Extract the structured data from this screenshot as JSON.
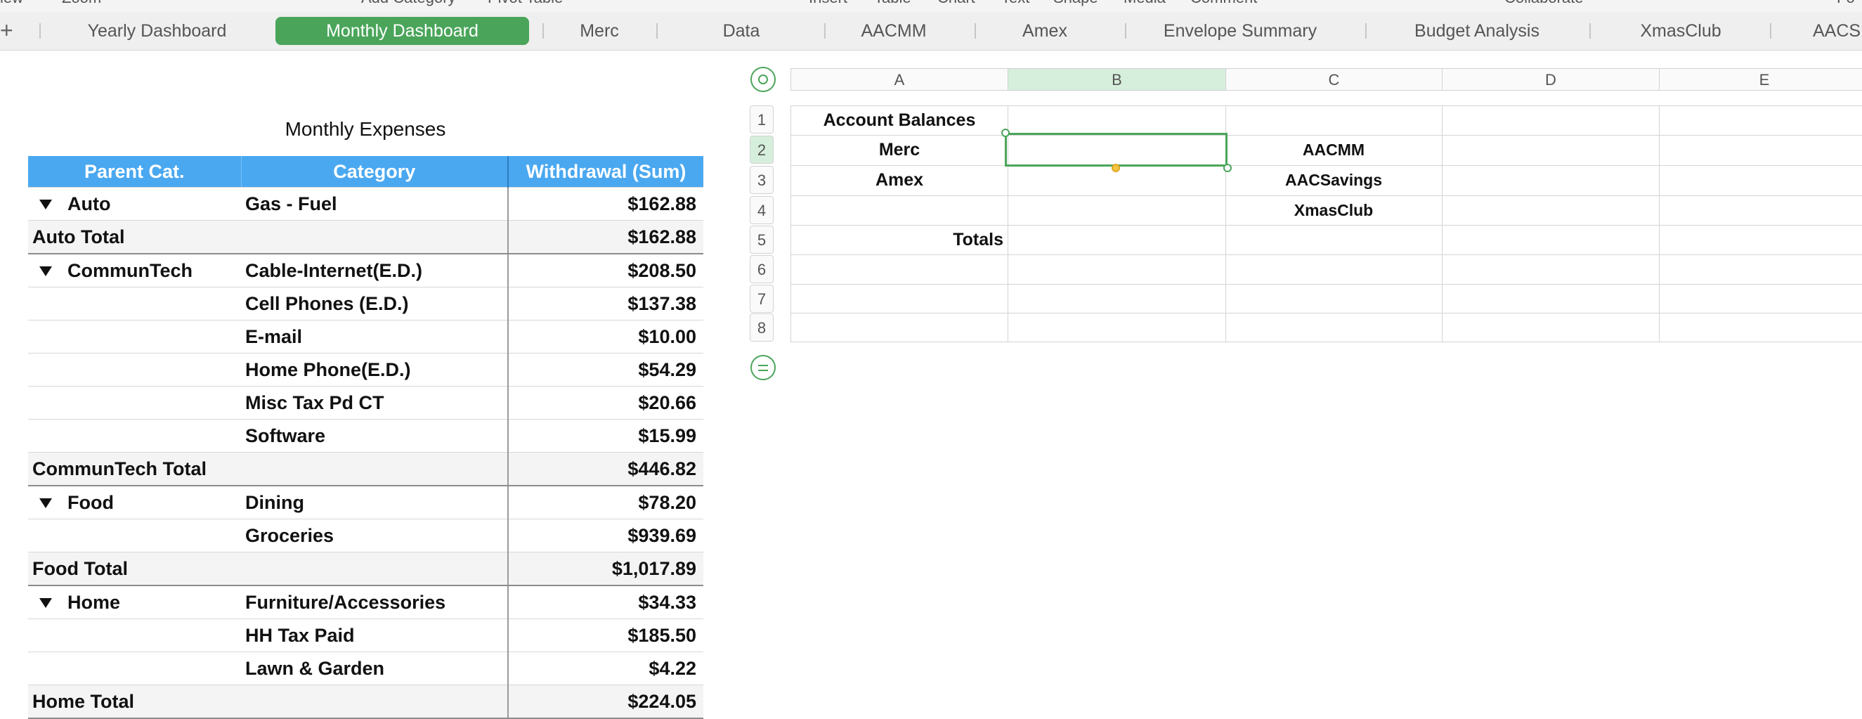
{
  "toolbar": {
    "labels": [
      "iew",
      "Zoom",
      "Add Category",
      "Pivot Table",
      "Insert",
      "Table",
      "Chart",
      "Text",
      "Shape",
      "Media",
      "Comment",
      "Collaborate",
      "Fo"
    ]
  },
  "tabs": [
    {
      "label": "Yearly Dashboard",
      "active": false
    },
    {
      "label": "Monthly Dashboard",
      "active": true
    },
    {
      "label": "Merc",
      "active": false
    },
    {
      "label": "Data",
      "active": false
    },
    {
      "label": "AACMM",
      "active": false
    },
    {
      "label": "Amex",
      "active": false
    },
    {
      "label": "Envelope Summary",
      "active": false
    },
    {
      "label": "Budget Analysis",
      "active": false
    },
    {
      "label": "XmasClub",
      "active": false
    },
    {
      "label": "AACS",
      "active": false
    }
  ],
  "add_sheet_label": "+",
  "pivot": {
    "title": "Monthly Expenses",
    "headers": [
      "Parent Cat.",
      "Category",
      "Withdrawal (Sum)"
    ],
    "rows": [
      {
        "parent": "Auto",
        "category": "Gas - Fuel",
        "amount": "$162.88",
        "group_start": true
      },
      {
        "parent": "Auto Total",
        "category": "",
        "amount": "$162.88",
        "total": true
      },
      {
        "parent": "CommunTech",
        "category": "Cable-Internet(E.D.)",
        "amount": "$208.50",
        "group_start": true
      },
      {
        "parent": "",
        "category": "Cell Phones (E.D.)",
        "amount": "$137.38"
      },
      {
        "parent": "",
        "category": "E-mail",
        "amount": "$10.00"
      },
      {
        "parent": "",
        "category": "Home Phone(E.D.)",
        "amount": "$54.29"
      },
      {
        "parent": "",
        "category": "Misc Tax Pd CT",
        "amount": "$20.66"
      },
      {
        "parent": "",
        "category": "Software",
        "amount": "$15.99"
      },
      {
        "parent": "CommunTech Total",
        "category": "",
        "amount": "$446.82",
        "total": true
      },
      {
        "parent": "Food",
        "category": "Dining",
        "amount": "$78.20",
        "group_start": true
      },
      {
        "parent": "",
        "category": "Groceries",
        "amount": "$939.69"
      },
      {
        "parent": "Food Total",
        "category": "",
        "amount": "$1,017.89",
        "total": true
      },
      {
        "parent": "Home",
        "category": "Furniture/Accessories",
        "amount": "$34.33",
        "group_start": true
      },
      {
        "parent": "",
        "category": "HH Tax Paid",
        "amount": "$185.50"
      },
      {
        "parent": "",
        "category": "Lawn & Garden",
        "amount": "$4.22"
      },
      {
        "parent": "Home Total",
        "category": "",
        "amount": "$224.05",
        "total": true
      }
    ]
  },
  "sheet": {
    "columns": [
      "A",
      "B",
      "C",
      "D",
      "E"
    ],
    "selected_column": "B",
    "rows": [
      "1",
      "2",
      "3",
      "4",
      "5",
      "6",
      "7",
      "8"
    ],
    "selected_row": "2",
    "cells": {
      "A1": "Account Balances",
      "A2": "Merc",
      "A3": "Amex",
      "A5": "Totals",
      "C2": "AACMM",
      "C3": "AACSavings",
      "C4": "XmasClub"
    }
  },
  "colors": {
    "accent_green": "#4aa55a",
    "header_blue": "#4aa8f0",
    "selected_header": "#d6efdc"
  }
}
